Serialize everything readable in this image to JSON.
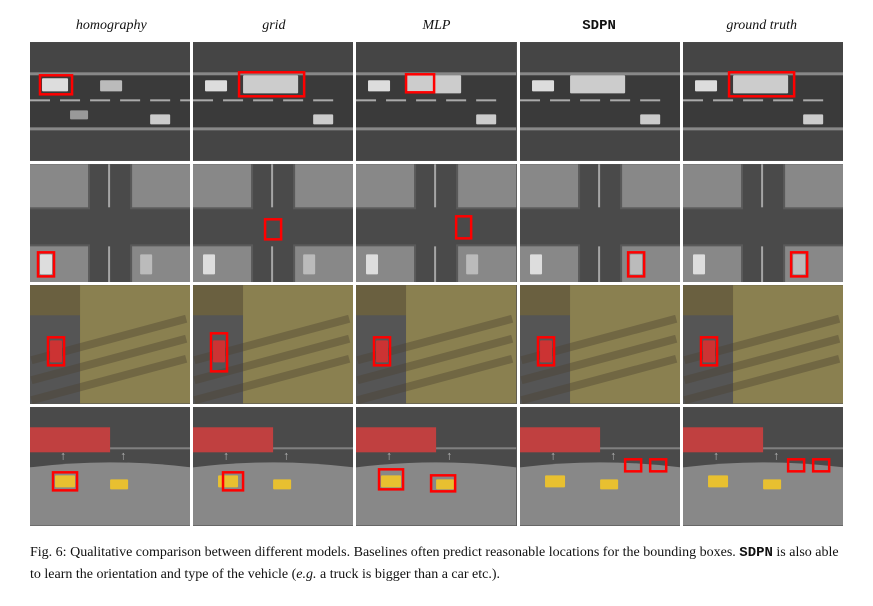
{
  "header": {
    "columns": [
      {
        "label": "homography",
        "style": "italic"
      },
      {
        "label": "grid",
        "style": "italic"
      },
      {
        "label": "MLP",
        "style": "italic"
      },
      {
        "label": "SDPN",
        "style": "bold"
      },
      {
        "label": "ground truth",
        "style": "italic"
      }
    ]
  },
  "caption": {
    "fig_number": "Fig. 6:",
    "text": " Qualitative comparison between different models. Baselines often predict reasonable locations for the bounding boxes. ",
    "sdpn": "SDPN",
    "text2": " is also able to learn the orientation and type of the vehicle (",
    "eg": "e.g.",
    "text3": " a truck is bigger than a car etc.)."
  }
}
